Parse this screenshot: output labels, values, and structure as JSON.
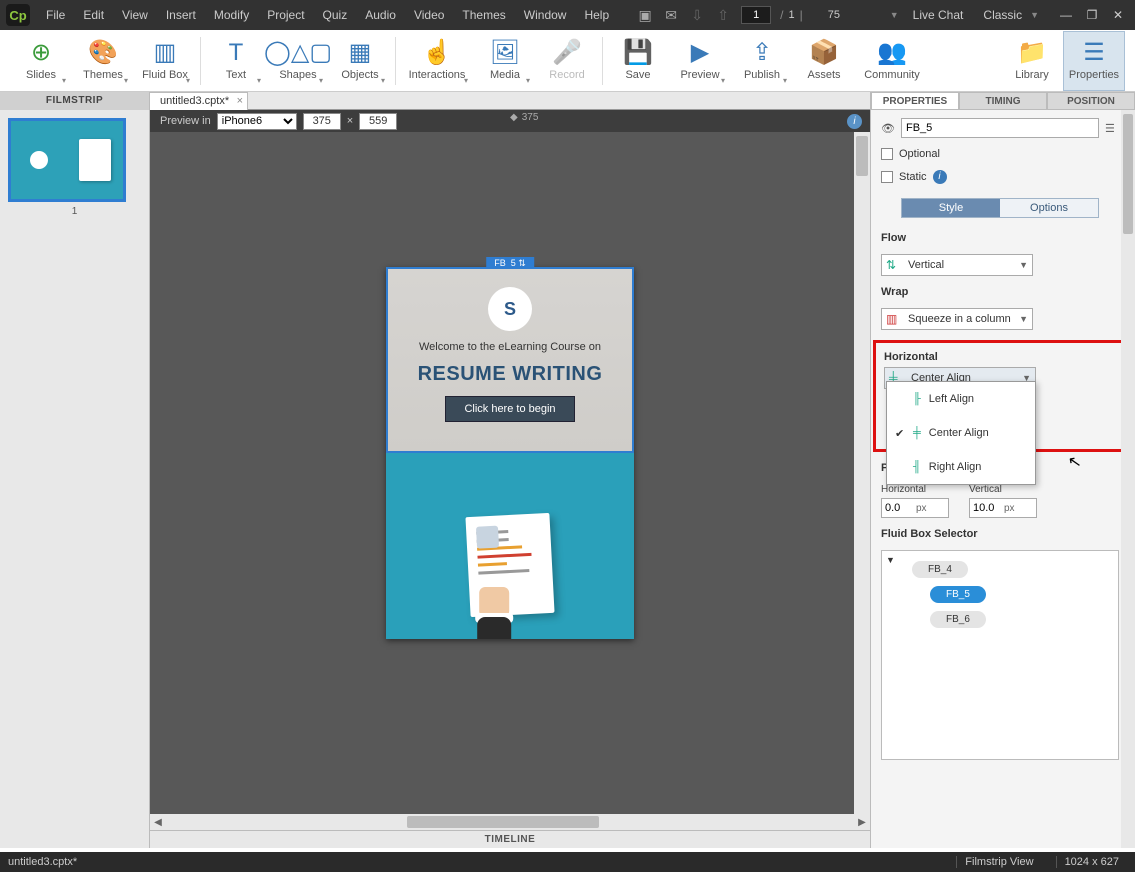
{
  "menu": {
    "items": [
      "File",
      "Edit",
      "View",
      "Insert",
      "Modify",
      "Project",
      "Quiz",
      "Audio",
      "Video",
      "Themes",
      "Window",
      "Help"
    ],
    "page_current": "1",
    "page_total": "1",
    "zoom": "75",
    "live_chat": "Live Chat",
    "theme": "Classic"
  },
  "ribbon": {
    "tools": [
      "Slides",
      "Themes",
      "Fluid Box",
      "Text",
      "Shapes",
      "Objects",
      "Interactions",
      "Media",
      "Record",
      "Save",
      "Preview",
      "Publish",
      "Assets",
      "Community",
      "Library",
      "Properties"
    ]
  },
  "filmstrip": {
    "title": "FILMSTRIP",
    "slide_number": "1"
  },
  "doc": {
    "tab": "untitled3.cptx*"
  },
  "preview": {
    "label": "Preview in",
    "device": "iPhone6",
    "w": "375",
    "h": "559",
    "ruler_val": "375"
  },
  "slide": {
    "fb_label": "FB_5 ⇅",
    "welcome": "Welcome to the eLearning Course on",
    "title": "RESUME WRITING",
    "button": "Click here to begin"
  },
  "timeline": {
    "title": "TIMELINE"
  },
  "props": {
    "tabs": [
      "PROPERTIES",
      "TIMING",
      "POSITION"
    ],
    "name": "FB_5",
    "optional": "Optional",
    "static": "Static",
    "subtabs": [
      "Style",
      "Options"
    ],
    "flow": {
      "label": "Flow",
      "value": "Vertical"
    },
    "wrap": {
      "label": "Wrap",
      "value": "Squeeze in a column"
    },
    "horizontal": {
      "label": "Horizontal",
      "value": "Center Align",
      "options": [
        "Left Align",
        "Center Align",
        "Right Align"
      ],
      "selected": "Center Align"
    },
    "padding": {
      "label": "Padding",
      "h_label": "Horizontal",
      "v_label": "Vertical",
      "h_val": "0.0",
      "v_val": "10.0",
      "unit": "px"
    },
    "fbsel": {
      "label": "Fluid Box Selector",
      "items": [
        "FB_4",
        "FB_5",
        "FB_6"
      ],
      "selected": "FB_5"
    }
  },
  "status": {
    "file": "untitled3.cptx*",
    "mode": "Filmstrip View",
    "dims": "1024 x 627"
  }
}
